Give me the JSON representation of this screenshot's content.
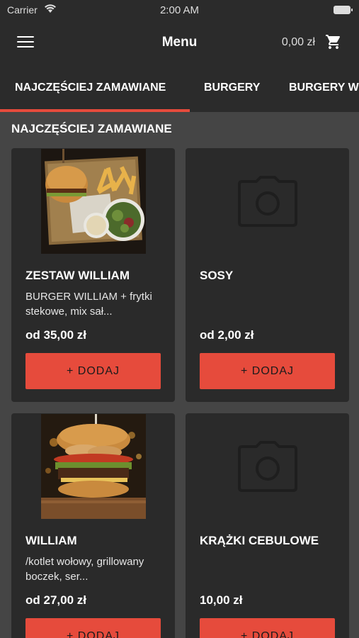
{
  "status_bar": {
    "carrier": "Carrier",
    "time": "2:00 AM"
  },
  "header": {
    "title": "Menu",
    "cart_total": "0,00 zł"
  },
  "tabs": [
    {
      "label": "NAJCZĘŚCIEJ ZAMAWIANE",
      "active": true
    },
    {
      "label": "BURGERY",
      "active": false
    },
    {
      "label": "BURGERY W",
      "active": false
    }
  ],
  "section": {
    "title": "NAJCZĘŚCIEJ ZAMAWIANE"
  },
  "products": [
    {
      "name": "ZESTAW WILLIAM",
      "description": "BURGER WILLIAM + frytki stekowe, mix sał...",
      "price": "od 35,00 zł",
      "button": "+ DODAJ",
      "image": "photo"
    },
    {
      "name": "SOSY",
      "description": "",
      "price": "od 2,00 zł",
      "button": "+ DODAJ",
      "image": "camera-placeholder"
    },
    {
      "name": "WILLIAM",
      "description": "/kotlet wołowy, grillowany boczek, ser...",
      "price": "od 27,00 zł",
      "button": "+ DODAJ",
      "image": "photo"
    },
    {
      "name": "KRĄŻKI CEBULOWE",
      "description": "",
      "price": "10,00 zł",
      "button": "+ DODAJ",
      "image": "camera-placeholder"
    }
  ],
  "colors": {
    "accent": "#e64b3c",
    "background": "#454545",
    "card": "#2a2a2a",
    "bar": "#2b2b2b"
  }
}
